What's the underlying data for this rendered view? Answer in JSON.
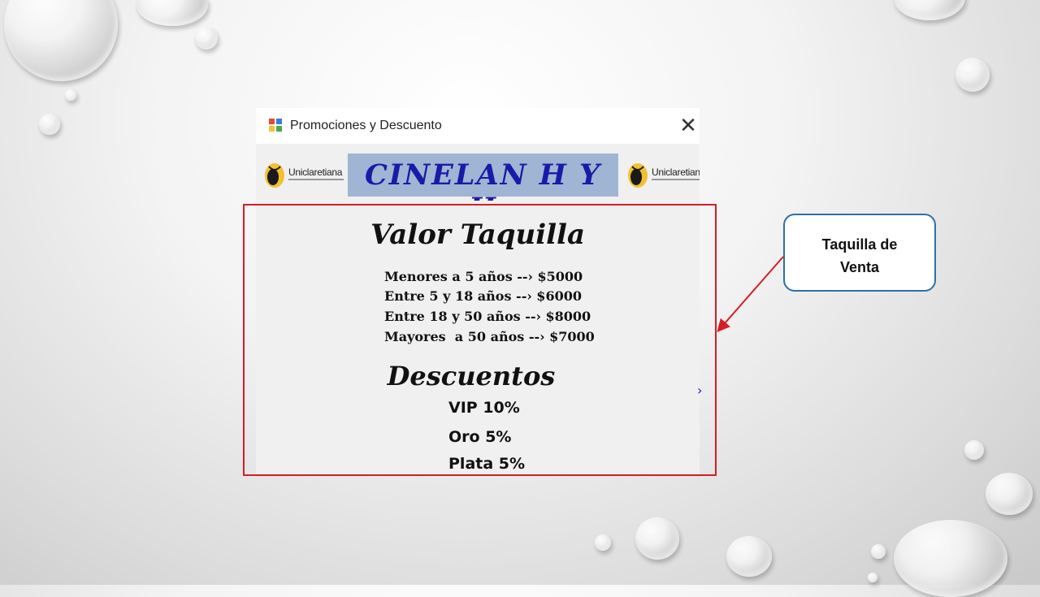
{
  "window": {
    "title": "Promociones y Descuento",
    "close_symbol": "✕",
    "app_icon": "form-app-icon"
  },
  "header": {
    "logo_left_text": "Uniclaretiana",
    "logo_right_text": "Uniclaretiana",
    "banner_text": "CINELAN H Y H"
  },
  "prices": {
    "heading": "Valor Taquilla",
    "lines": [
      "Menores a 5 años --› $5000",
      "Entre 5 y 18 años --› $6000",
      "Entre 18 y 50 años --› $8000",
      "Mayores  a 50 años --› $7000"
    ]
  },
  "discounts": {
    "heading": "Descuentos",
    "lines": [
      "VIP 10%",
      "Oro 5%",
      "Plata 5%"
    ]
  },
  "callout": {
    "line1": "Taquilla de",
    "line2": "Venta"
  },
  "colors": {
    "highlight": "#d41e24",
    "callout_border": "#2e6fa8",
    "banner_bg": "#9fb5d3",
    "banner_text": "#1a1aa8"
  }
}
